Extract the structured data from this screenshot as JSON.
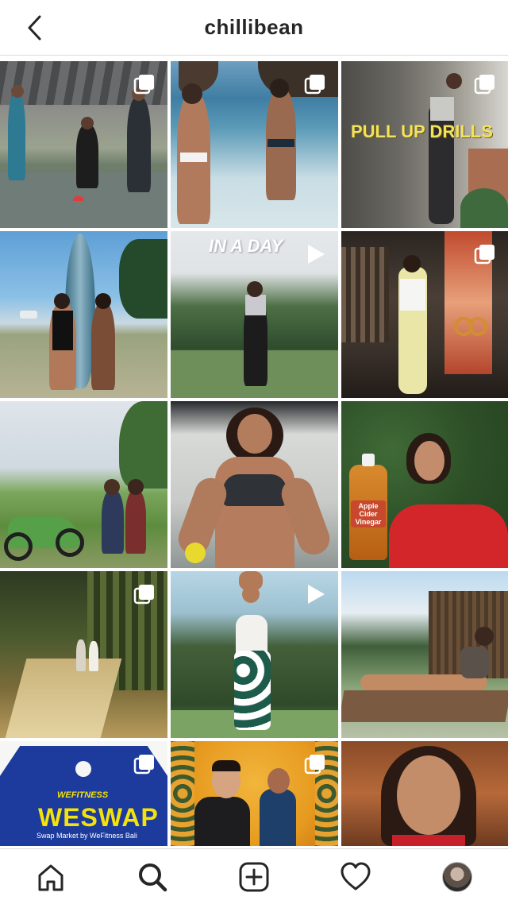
{
  "header": {
    "title": "chillibean",
    "back_icon": "chevron-left-icon"
  },
  "grid": {
    "tiles": [
      {
        "name": "tile-outdoor-court-training",
        "overlay": "multi"
      },
      {
        "name": "tile-beach-swimsuits",
        "overlay": "multi"
      },
      {
        "name": "tile-pull-up-drills",
        "overlay": "multi",
        "text": "PULL UP DRILLS"
      },
      {
        "name": "tile-surfboard-beach",
        "overlay": "none"
      },
      {
        "name": "tile-in-a-day",
        "overlay": "video",
        "text": "IN A DAY"
      },
      {
        "name": "tile-gym-rings",
        "overlay": "multi"
      },
      {
        "name": "tile-dirt-bike-ricefield",
        "overlay": "none"
      },
      {
        "name": "tile-sports-bra-portrait",
        "overlay": "none"
      },
      {
        "name": "tile-apple-cider-vinegar",
        "overlay": "none",
        "text": "Apple Cider Vinegar"
      },
      {
        "name": "tile-bamboo-forest-hike",
        "overlay": "multi"
      },
      {
        "name": "tile-stretch-garden",
        "overlay": "video"
      },
      {
        "name": "tile-pool-lounger",
        "overlay": "none"
      },
      {
        "name": "tile-weswap-poster",
        "overlay": "multi",
        "text": "WESWAP",
        "brand": "WEFITNESS",
        "subtext": "Swap Market by WeFitness Bali"
      },
      {
        "name": "tile-wedding-couple",
        "overlay": "multi"
      },
      {
        "name": "tile-portrait-smile",
        "overlay": "none"
      }
    ]
  },
  "nav": {
    "items": [
      {
        "name": "home",
        "icon": "home-icon"
      },
      {
        "name": "search",
        "icon": "search-icon"
      },
      {
        "name": "new-post",
        "icon": "add-post-icon"
      },
      {
        "name": "activity",
        "icon": "heart-icon"
      },
      {
        "name": "profile",
        "icon": "avatar"
      }
    ]
  },
  "colors": {
    "weswap_blue": "#1d3b9c",
    "weswap_yellow": "#f4e20b",
    "pullup_yellow": "#f3e35c"
  }
}
